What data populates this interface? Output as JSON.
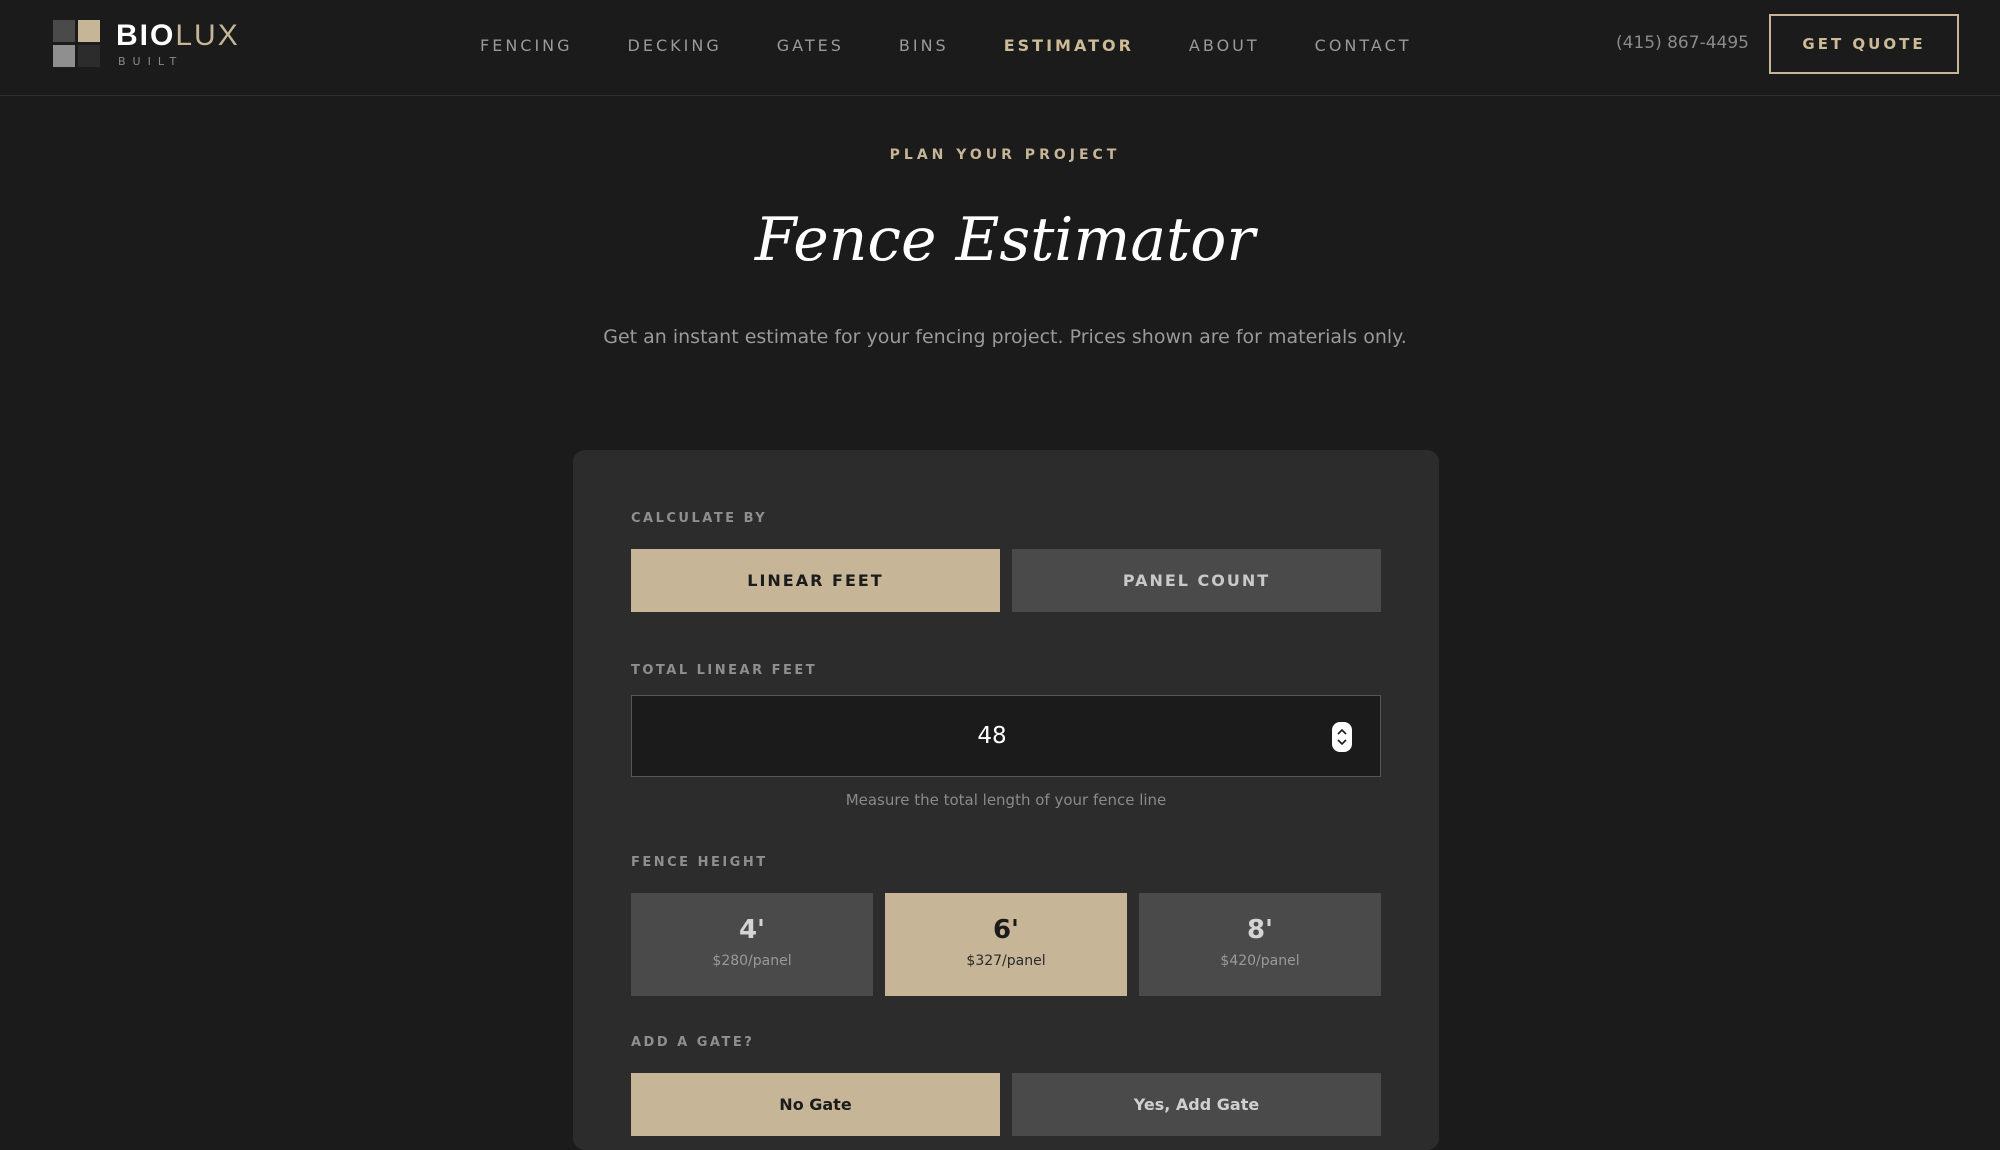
{
  "header": {
    "logo": {
      "bold": "BIO",
      "light": "LUX",
      "sub": "BUILT"
    },
    "nav": [
      {
        "label": "FENCING",
        "active": false
      },
      {
        "label": "DECKING",
        "active": false
      },
      {
        "label": "GATES",
        "active": false
      },
      {
        "label": "BINS",
        "active": false
      },
      {
        "label": "ESTIMATOR",
        "active": true
      },
      {
        "label": "ABOUT",
        "active": false
      },
      {
        "label": "CONTACT",
        "active": false
      }
    ],
    "phone": "(415) 867-4495",
    "cta": "GET QUOTE"
  },
  "hero": {
    "eyebrow": "PLAN YOUR PROJECT",
    "title": "Fence Estimator",
    "subtitle": "Get an instant estimate for your fencing project. Prices shown are for materials only."
  },
  "estimator": {
    "calculate_by": {
      "label": "CALCULATE BY",
      "options": [
        {
          "label": "LINEAR FEET",
          "selected": true
        },
        {
          "label": "PANEL COUNT",
          "selected": false
        }
      ]
    },
    "linear_feet": {
      "label": "TOTAL LINEAR FEET",
      "value": "48",
      "helper": "Measure the total length of your fence line"
    },
    "height": {
      "label": "FENCE HEIGHT",
      "options": [
        {
          "value": "4'",
          "price": "$280/panel",
          "selected": false
        },
        {
          "value": "6'",
          "price": "$327/panel",
          "selected": true
        },
        {
          "value": "8'",
          "price": "$420/panel",
          "selected": false
        }
      ]
    },
    "gate": {
      "label": "ADD A GATE?",
      "options": [
        {
          "label": "No Gate",
          "selected": true
        },
        {
          "label": "Yes, Add Gate",
          "selected": false
        }
      ]
    }
  },
  "colors": {
    "background": "#1b1b1b",
    "card": "#2c2c2c",
    "accent": "#c6b597",
    "inactive_button": "#4a4a4a"
  }
}
